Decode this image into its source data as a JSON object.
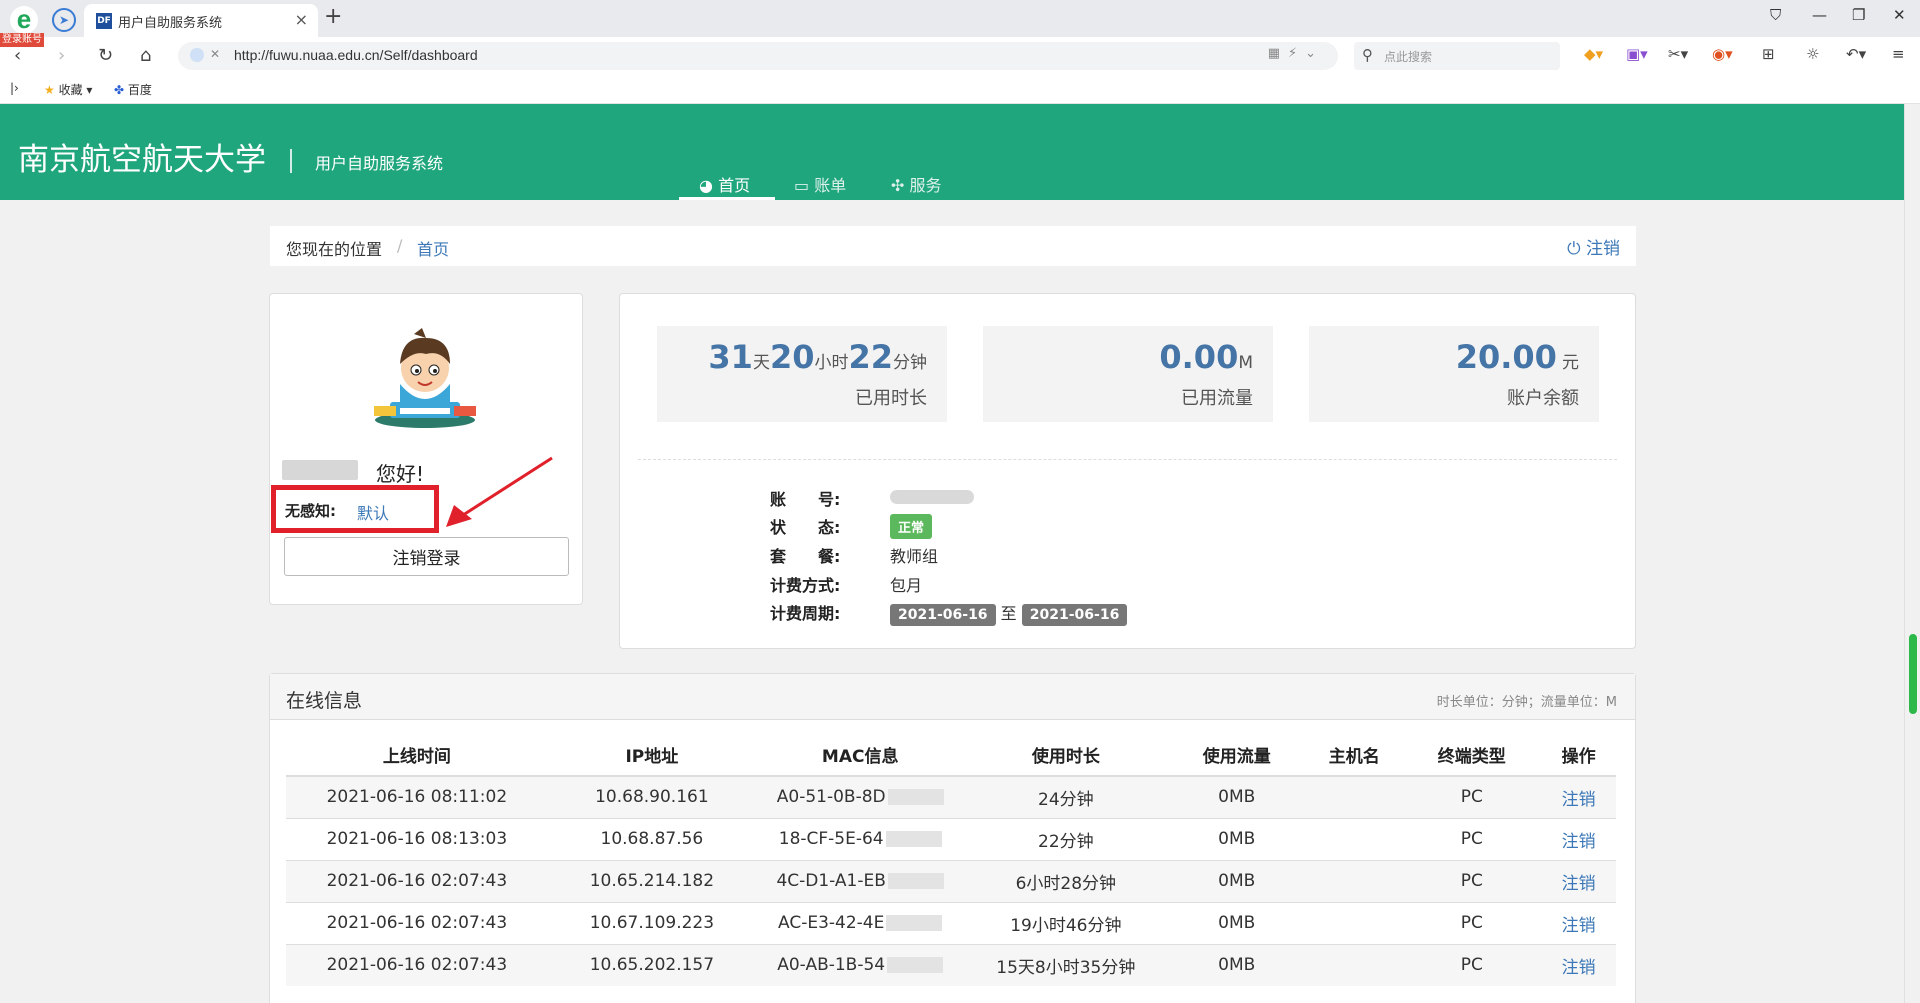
{
  "browser": {
    "login_badge": "登录账号",
    "tab_title": "用户自助服务系统",
    "favicon_text": "DF",
    "url": "http://fuwu.nuaa.edu.cn/Self/dashboard",
    "search_placeholder": "点此搜索",
    "bookmarks": [
      "收藏",
      "百度"
    ]
  },
  "header": {
    "school": "南京航空航天大学",
    "system": "用户自助服务系统",
    "nav": [
      {
        "label": "首页",
        "icon": "dashboard-icon",
        "active": true
      },
      {
        "label": "账单",
        "icon": "money-icon",
        "active": false
      },
      {
        "label": "服务",
        "icon": "puzzle-icon",
        "active": false
      }
    ]
  },
  "breadcrumb": {
    "location_label": "您现在的位置",
    "separator": "/",
    "current": "首页",
    "logout": "注销"
  },
  "user": {
    "greeting": "您好!",
    "aware_label": "无感知:",
    "aware_value": "默认",
    "logout_button": "注销登录"
  },
  "stats": {
    "duration": {
      "days": "31",
      "days_unit": "天",
      "hours": "20",
      "hours_unit": "小时",
      "minutes": "22",
      "minutes_unit": "分钟",
      "label": "已用时长"
    },
    "traffic": {
      "value": "0.00",
      "unit": "M",
      "label": "已用流量"
    },
    "balance": {
      "value": "20.00",
      "unit": "元",
      "label": "账户余额"
    }
  },
  "account": {
    "account_label": "账　　号:",
    "status_label": "状　　态:",
    "status": "正常",
    "package_label": "套　　餐:",
    "package": "教师组",
    "billing_label": "计费方式:",
    "billing": "包月",
    "period_label": "计费周期:",
    "period_start": "2021-06-16",
    "period_to": "至",
    "period_end": "2021-06-16"
  },
  "online": {
    "title": "在线信息",
    "units": "时长单位：分钟；流量单位：M",
    "columns": [
      "上线时间",
      "IP地址",
      "MAC信息",
      "使用时长",
      "使用流量",
      "主机名",
      "终端类型",
      "操作"
    ],
    "rows": [
      {
        "time": "2021-06-16 08:11:02",
        "ip": "10.68.90.161",
        "mac": "A0-51-0B-8D",
        "duration": "24分钟",
        "traffic": "0MB",
        "host": "",
        "terminal": "PC",
        "action": "注销"
      },
      {
        "time": "2021-06-16 08:13:03",
        "ip": "10.68.87.56",
        "mac": "18-CF-5E-64",
        "duration": "22分钟",
        "traffic": "0MB",
        "host": "",
        "terminal": "PC",
        "action": "注销"
      },
      {
        "time": "2021-06-16 02:07:43",
        "ip": "10.65.214.182",
        "mac": "4C-D1-A1-EB",
        "duration": "6小时28分钟",
        "traffic": "0MB",
        "host": "",
        "terminal": "PC",
        "action": "注销"
      },
      {
        "time": "2021-06-16 02:07:43",
        "ip": "10.67.109.223",
        "mac": "AC-E3-42-4E",
        "duration": "19小时46分钟",
        "traffic": "0MB",
        "host": "",
        "terminal": "PC",
        "action": "注销"
      },
      {
        "time": "2021-06-16 02:07:43",
        "ip": "10.65.202.157",
        "mac": "A0-AB-1B-54",
        "duration": "15天8小时35分钟",
        "traffic": "0MB",
        "host": "",
        "terminal": "PC",
        "action": "注销"
      }
    ]
  },
  "colors": {
    "header_green": "#20a67c",
    "link_blue": "#3c78b7",
    "annotation_red": "#e0202a",
    "status_green": "#5cb85c"
  }
}
